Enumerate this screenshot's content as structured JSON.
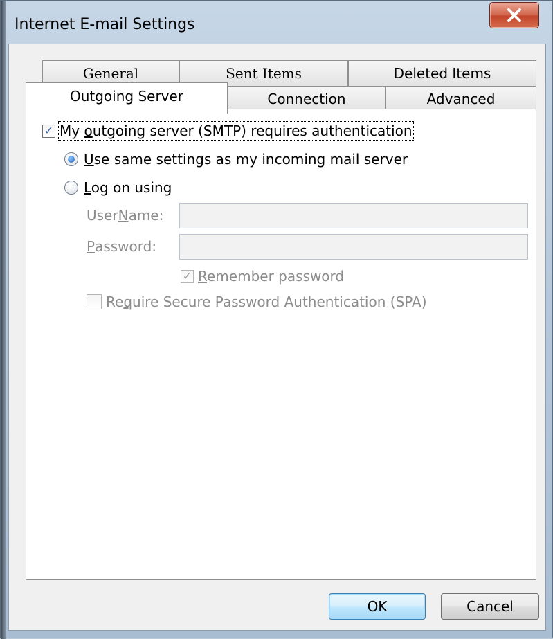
{
  "window": {
    "title": "Internet E-mail Settings",
    "close_glyph": "✕"
  },
  "tabs_back": [
    {
      "label": "General"
    },
    {
      "label": "Sent Items"
    },
    {
      "label": "Deleted Items"
    }
  ],
  "tabs_front": [
    {
      "label": "Outgoing Server",
      "active": true
    },
    {
      "label": "Connection"
    },
    {
      "label": "Advanced"
    }
  ],
  "auth": {
    "requires_auth_label_pre": "My ",
    "requires_auth_label_u": "o",
    "requires_auth_label_post": "utgoing server (SMTP) requires authentication",
    "requires_auth_checked": true,
    "same_settings_label_u": "U",
    "same_settings_label_post": "se same settings as my incoming mail server",
    "same_settings_selected": true,
    "log_on_label_u": "L",
    "log_on_label_post": "og on using",
    "log_on_selected": false
  },
  "fields": {
    "username_label_pre": "User ",
    "username_label_u": "N",
    "username_label_post": "ame:",
    "username_value": "",
    "password_label_u": "P",
    "password_label_post": "assword:",
    "password_value": ""
  },
  "remember": {
    "label_u": "R",
    "label_post": "emember password",
    "checked": true
  },
  "spa": {
    "label_pre": "Re",
    "label_u": "q",
    "label_post": "uire Secure Password Authentication (SPA)",
    "checked": false
  },
  "buttons": {
    "ok": "OK",
    "cancel": "Cancel"
  },
  "check_glyph": "✓"
}
